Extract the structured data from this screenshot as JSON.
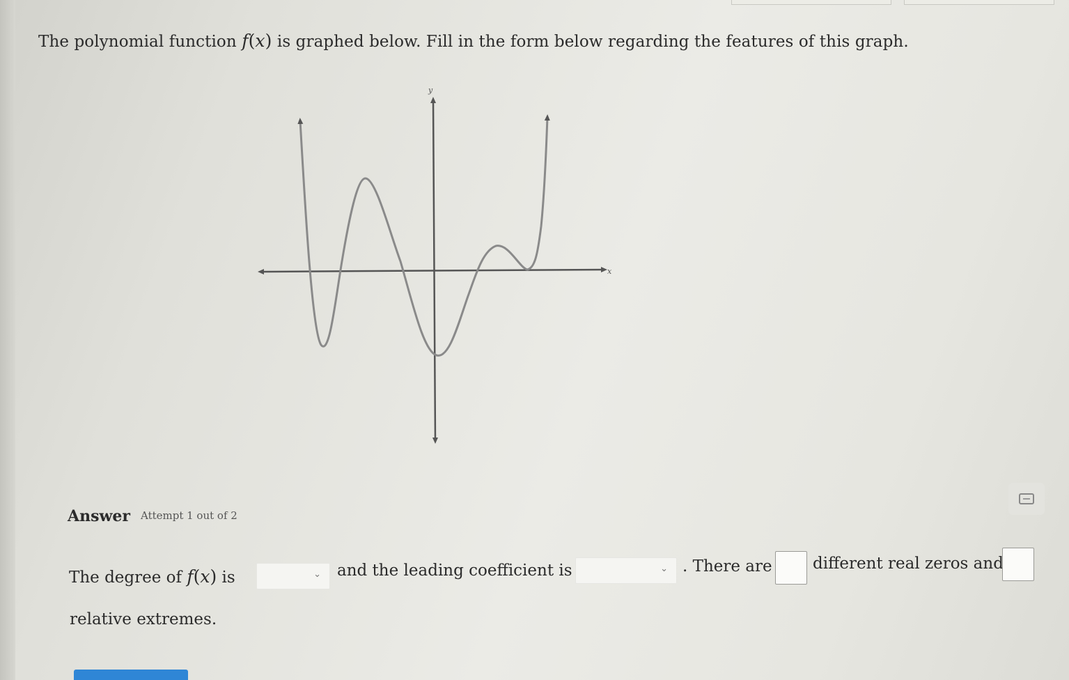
{
  "question": {
    "text_before": "The polynomial function ",
    "func_name": "f",
    "func_var": "x",
    "text_after": " is graphed below. Fill in the form below regarding the features of this graph."
  },
  "graph": {
    "x_axis_label": "x",
    "y_axis_label": "y",
    "curve_color": "#8a8a8a",
    "axis_color": "#555555"
  },
  "answer": {
    "label": "Answer",
    "attempt": "Attempt 1 out of 2"
  },
  "form": {
    "degree_prefix": "The degree of ",
    "func_name": "f",
    "func_var": "x",
    "degree_suffix": " is",
    "degree_value": "",
    "leading_text": "and the leading coefficient is",
    "leading_value": "",
    "there_are": ". There are",
    "zeros_value": "",
    "zeros_text": "different real zeros and",
    "extremes_value": "",
    "extremes_text": "relative extremes."
  },
  "icons": {
    "chevron": "chevron-down-icon",
    "calculator": "calculator-icon"
  },
  "colors": {
    "submit": "#2f86d6"
  }
}
